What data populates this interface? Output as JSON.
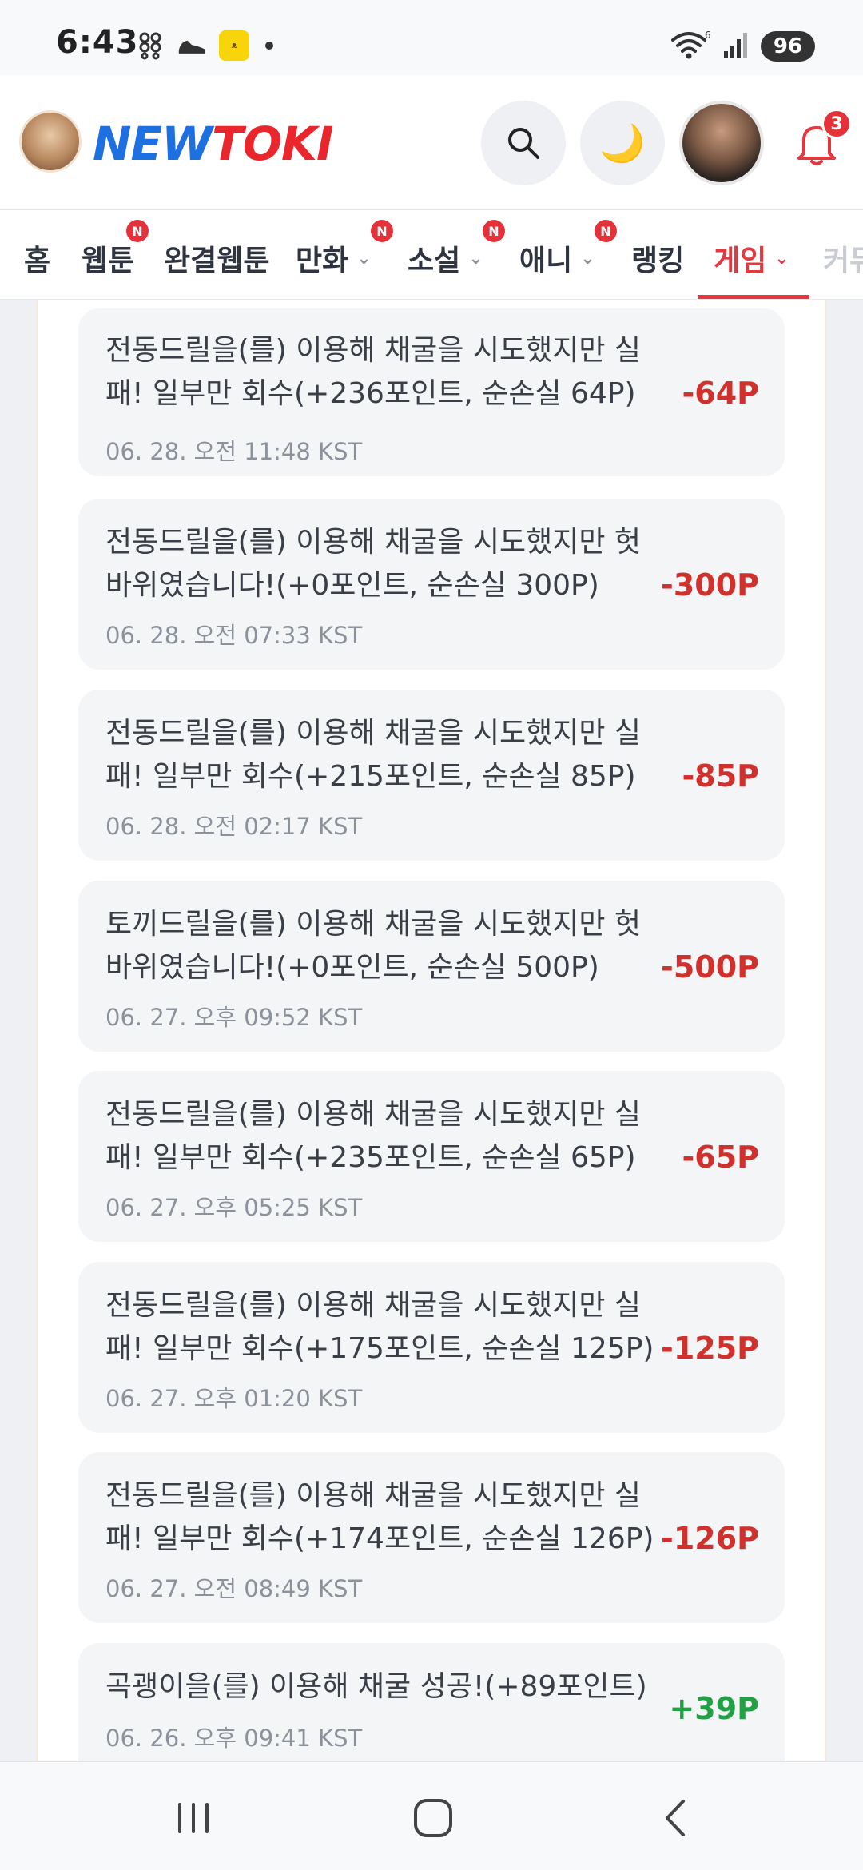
{
  "status_bar": {
    "time": "6:43",
    "battery": "96",
    "wifi_label": "6"
  },
  "header": {
    "logo_left": "NEW",
    "logo_right": "TOKI",
    "notification_count": "3",
    "moon_glyph": "🌙"
  },
  "nav": {
    "items": [
      {
        "label": "홈"
      },
      {
        "label": "웹툰",
        "badge": "N"
      },
      {
        "label": "완결웹툰"
      },
      {
        "label": "만화",
        "badge": "N"
      },
      {
        "label": "소설",
        "badge": "N"
      },
      {
        "label": "애니",
        "badge": "N"
      },
      {
        "label": "랭킹"
      },
      {
        "label": "게임"
      },
      {
        "label": "커뮤"
      }
    ],
    "chevron": "⌄"
  },
  "history": [
    {
      "desc": "전동드릴을(를) 이용해 채굴을 시도했지만 실패! 일부만 회수(+236포인트, 순손실 64P)",
      "time": "06. 28. 오전 11:48 KST",
      "amount": "-64P"
    },
    {
      "desc": "전동드릴을(를) 이용해 채굴을 시도했지만 헛바위였습니다!(+0포인트, 순손실 300P)",
      "time": "06. 28. 오전 07:33 KST",
      "amount": "-300P"
    },
    {
      "desc": "전동드릴을(를) 이용해 채굴을 시도했지만 실패! 일부만 회수(+215포인트, 순손실 85P)",
      "time": "06. 28. 오전 02:17 KST",
      "amount": "-85P"
    },
    {
      "desc": "토끼드릴을(를) 이용해 채굴을 시도했지만 헛바위였습니다!(+0포인트, 순손실 500P)",
      "time": "06. 27. 오후 09:52 KST",
      "amount": "-500P"
    },
    {
      "desc": "전동드릴을(를) 이용해 채굴을 시도했지만 실패! 일부만 회수(+235포인트, 순손실 65P)",
      "time": "06. 27. 오후 05:25 KST",
      "amount": "-65P"
    },
    {
      "desc": "전동드릴을(를) 이용해 채굴을 시도했지만 실패! 일부만 회수(+175포인트, 순손실 125P)",
      "time": "06. 27. 오후 01:20 KST",
      "amount": "-125P"
    },
    {
      "desc": "전동드릴을(를) 이용해 채굴을 시도했지만 실패! 일부만 회수(+174포인트, 순손실 126P)",
      "time": "06. 27. 오전 08:49 KST",
      "amount": "-126P"
    },
    {
      "desc": "곡괭이을(를) 이용해 채굴 성공!(+89포인트)",
      "time": "06. 26. 오후 09:41 KST",
      "amount": "+39P"
    }
  ]
}
